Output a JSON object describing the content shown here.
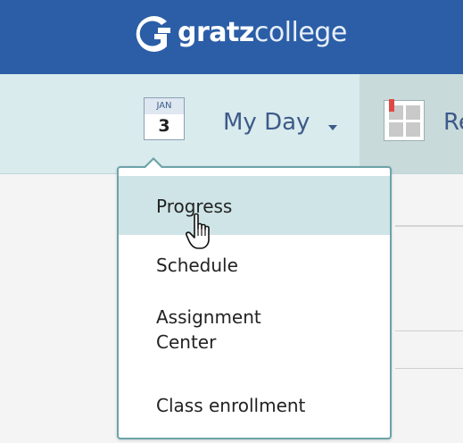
{
  "brand": {
    "name_bold": "gratz",
    "name_light": "college",
    "logo_icon": "gratz-g-logo",
    "color_primary": "#2b5ea7"
  },
  "nav": {
    "calendar": {
      "month": "JAN",
      "day": "3",
      "icon": "calendar-icon"
    },
    "myday": {
      "label": "My Day",
      "caret_icon": "caret-down-icon"
    },
    "reports": {
      "label": "Re",
      "icon": "report-grid-icon"
    }
  },
  "dropdown": {
    "accent_color": "#6ba3a8",
    "highlight_color": "#cfe4e6",
    "items": [
      {
        "label": "Progress",
        "active": true
      },
      {
        "label": "Schedule",
        "active": false
      },
      {
        "label": "Assignment\nCenter",
        "active": false
      },
      {
        "label": "Class enrollment",
        "active": false
      }
    ]
  },
  "cursor": {
    "icon": "hand-pointer-icon"
  }
}
